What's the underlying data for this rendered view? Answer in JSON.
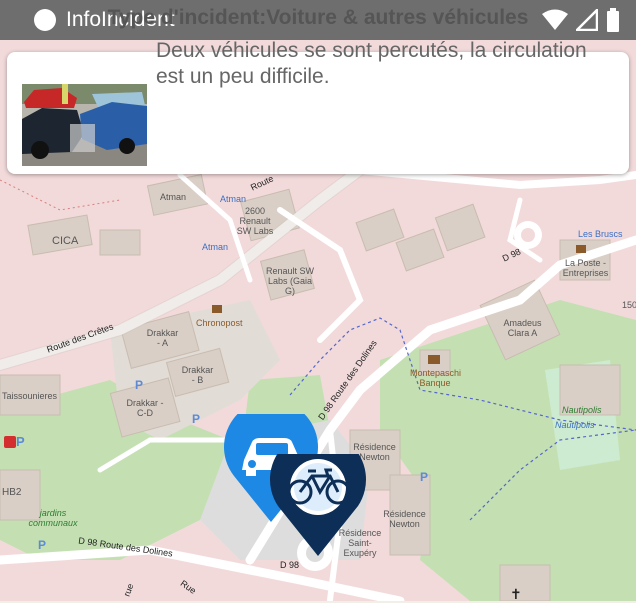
{
  "status_bar": {
    "app_name": "InfoIncident",
    "icons": [
      "wifi-icon",
      "signal-icon",
      "battery-icon"
    ]
  },
  "incident_card": {
    "title": "Type d'incident:Voiture & autres véhicules",
    "description": "Deux véhicules se sont percutés, la circulation est un peu difficile."
  },
  "map": {
    "labels": {
      "atman": "Atman",
      "atman_bus1": "Atman",
      "atman_bus2": "Atman",
      "renault_2600": "2600 Renault SW Labs",
      "cica": "CICA",
      "renault_gaia": "Renault SW Labs (Gaia G)",
      "chronopost": "Chronopost",
      "drakkar_a": "Drakkar - A",
      "drakkar_b": "Drakkar - B",
      "drakkar_cd": "Drakkar - C-D",
      "taissounieres": "Taissounieres",
      "hb2": "HB2",
      "jardins": "jardins communaux",
      "les_bruscs": "Les Bruscs",
      "la_poste": "La Poste - Entreprises",
      "amadeus": "Amadeus Clara A",
      "montepaschi": "Montepaschi Banque",
      "nautipolis1": "Nautipolis",
      "nautipolis2": "Nautipolis",
      "residence_newton1": "Résidence Newton",
      "residence_newton2": "Résidence Newton",
      "residence_st": "Résidence Saint-Exupéry",
      "num_150": "150"
    },
    "roads": {
      "route_cretes": "Route des Crêtes",
      "route_dolines": "D 98 Route des Dolines",
      "d98_dolines_bottom": "D 98 Route des Dolines",
      "d98_a": "D 98",
      "d98_b": "D 98",
      "route_top": "Route",
      "rue": "Rue",
      "rue2": "rue"
    },
    "markers": [
      "car-marker-icon",
      "bicycle-marker-icon"
    ],
    "colors": {
      "marker_blue": "#1e88e5",
      "marker_navy": "#0d2e57",
      "green_area": "#c4e0b3",
      "building": "#d9cfc6",
      "residential": "#f2dadb"
    }
  }
}
